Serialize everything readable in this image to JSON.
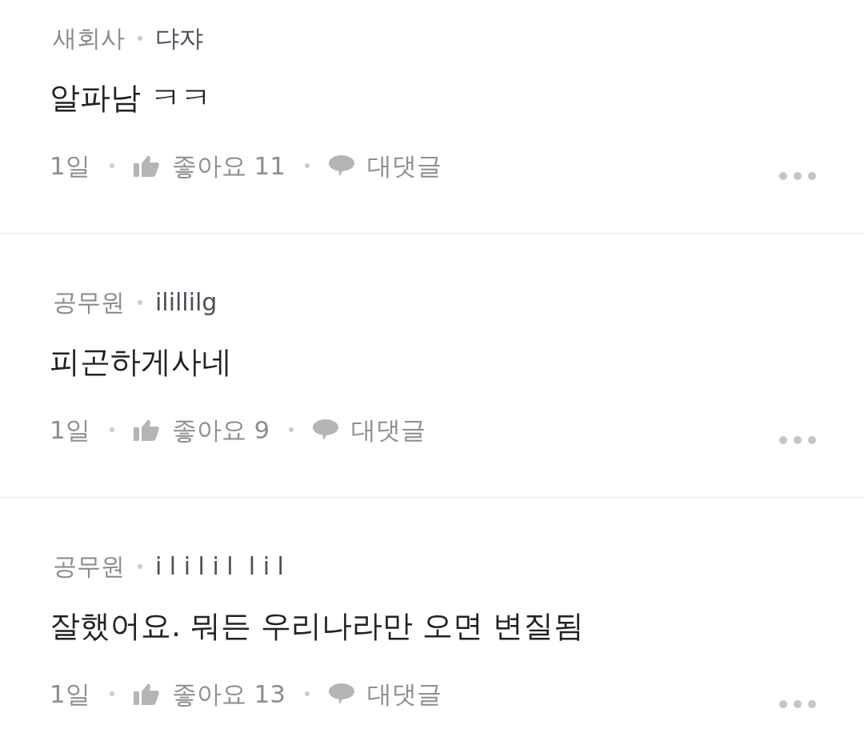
{
  "comments": [
    {
      "company": "새회사",
      "username": "댜쟈",
      "text": "알파남 ㅋㅋ",
      "time": "1일",
      "like_label": "좋아요",
      "like_count": "11",
      "reply_label": "대댓글"
    },
    {
      "company": "공무원",
      "username": "ilillilg",
      "text": "피곤하게사네",
      "time": "1일",
      "like_label": "좋아요",
      "like_count": "9",
      "reply_label": "대댓글"
    },
    {
      "company": "공무원",
      "username": "i l i l i l  l i l",
      "text": "잘했어요. 뭐든 우리나라만 오면 변질됨",
      "time": "1일",
      "like_label": "좋아요",
      "like_count": "13",
      "reply_label": "대댓글"
    }
  ]
}
